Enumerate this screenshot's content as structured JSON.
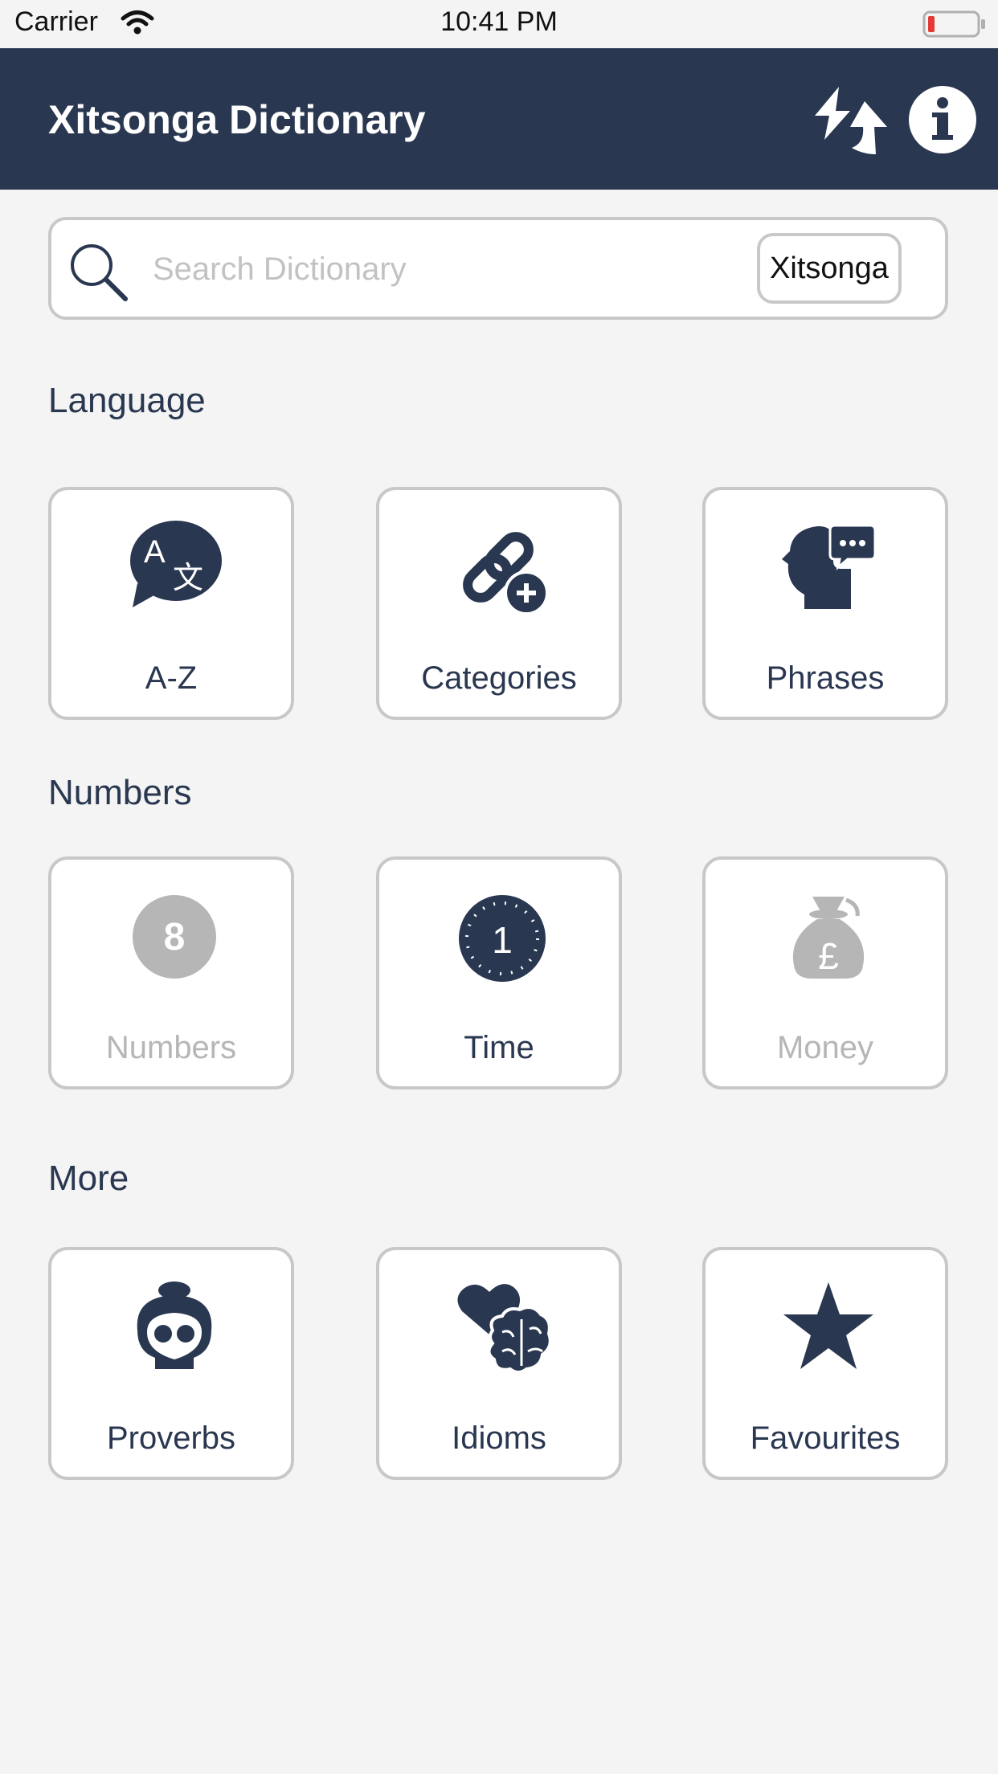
{
  "status_bar": {
    "carrier": "Carrier",
    "time": "10:41 PM"
  },
  "header": {
    "title": "Xitsonga Dictionary",
    "sync_icon": "sync-arrows-icon",
    "info_icon": "info-icon"
  },
  "search": {
    "placeholder": "Search Dictionary",
    "value": "",
    "language_label": "Xitsonga"
  },
  "sections": {
    "language": {
      "title": "Language",
      "tiles": [
        {
          "label": "A-Z",
          "icon": "translate-bubble-icon",
          "enabled": true
        },
        {
          "label": "Categories",
          "icon": "link-plus-icon",
          "enabled": true
        },
        {
          "label": "Phrases",
          "icon": "head-speech-icon",
          "enabled": true
        }
      ]
    },
    "numbers": {
      "title": "Numbers",
      "tiles": [
        {
          "label": "Numbers",
          "icon": "number-eight-icon",
          "enabled": false,
          "icon_text": "8"
        },
        {
          "label": "Time",
          "icon": "clock-icon",
          "enabled": true,
          "icon_text": "1"
        },
        {
          "label": "Money",
          "icon": "money-bag-icon",
          "enabled": false,
          "icon_text": "£"
        }
      ]
    },
    "more": {
      "title": "More",
      "tiles": [
        {
          "label": "Proverbs",
          "icon": "elder-face-icon",
          "enabled": true
        },
        {
          "label": "Idioms",
          "icon": "heart-brain-icon",
          "enabled": true
        },
        {
          "label": "Favourites",
          "icon": "star-icon",
          "enabled": true
        }
      ]
    }
  },
  "colors": {
    "header_bg": "#2a3750",
    "icon": "#2a3750",
    "disabled": "#b6b6b6",
    "background": "#f4f4f4",
    "border": "#c8c8c8",
    "battery_low": "#e53935"
  }
}
